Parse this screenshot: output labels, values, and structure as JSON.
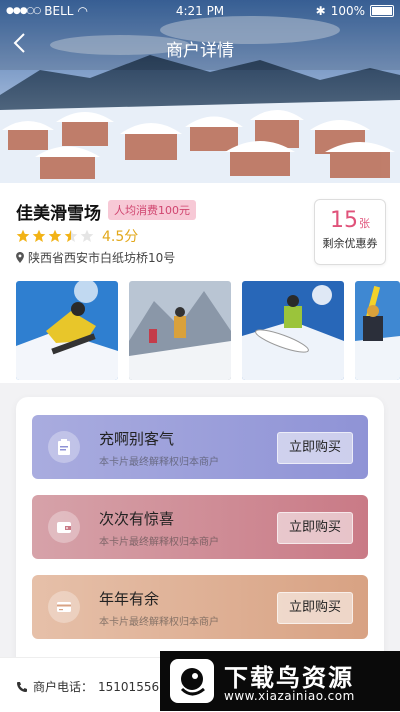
{
  "status_bar": {
    "carrier": "BELL",
    "time": "4:21 PM",
    "battery": "100%"
  },
  "nav": {
    "title": "商户详情"
  },
  "shop": {
    "name": "佳美滑雪场",
    "avg_spend": "人均消费100元",
    "rating": "4.5分",
    "rating_value": 4.5,
    "address": "陕西省西安市白纸坊桥10号"
  },
  "coupon": {
    "count": "15",
    "unit": "张",
    "label": "剩余优惠券"
  },
  "packages": [
    {
      "title": "充啊别客气",
      "subtitle": "本卡片最终解释权归本商户",
      "button": "立即购买",
      "icon": "clipboard-icon"
    },
    {
      "title": "次次有惊喜",
      "subtitle": "本卡片最终解释权归本商户",
      "button": "立即购买",
      "icon": "wallet-icon"
    },
    {
      "title": "年年有余",
      "subtitle": "本卡片最终解释权归本商户",
      "button": "立即购买",
      "icon": "card-icon"
    }
  ],
  "footer": {
    "phone_label": "商户电话：",
    "phone_number": "15101556"
  },
  "watermark": {
    "text": "下载鸟资源",
    "url": "www.xiazainiao.com"
  },
  "colors": {
    "accent_pink": "#e0527a",
    "star": "#f2b316",
    "card1": "#8f93d6",
    "card2": "#c97a86",
    "card3": "#d8a283"
  }
}
